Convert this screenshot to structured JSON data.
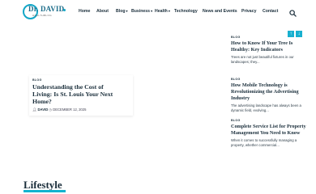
{
  "logo": {
    "name": "Dr. DAVID",
    "tagline": "HEALTHBLOG"
  },
  "nav": {
    "items": [
      {
        "label": "Home",
        "caret": ""
      },
      {
        "label": "About",
        "caret": ""
      },
      {
        "label": "Blog",
        "caret": "▾"
      },
      {
        "label": "Business",
        "caret": "▾"
      },
      {
        "label": "Health",
        "caret": "▾"
      },
      {
        "label": "Technology",
        "caret": ""
      },
      {
        "label": "News and Events",
        "caret": ""
      },
      {
        "label": "Privacy",
        "caret": ""
      },
      {
        "label": "Contact",
        "caret": ""
      }
    ],
    "search_icon": "search-icon"
  },
  "featured": {
    "category": "BLOG",
    "title": "Understanding the Cost of Living: Is St. Louis Your Next Home?",
    "author": "DAVID",
    "date": "DECEMBER 12, 2025"
  },
  "side_posts": [
    {
      "category": "BLOG",
      "title": "How to Know If Your Tree Is Healthy: Key Indicators",
      "excerpt": "Trees are not just beautiful fixtures in our landscapes; they..."
    },
    {
      "category": "BLOG",
      "title": "How Mobile Technology is Revolutionizing the Advertising Industry",
      "excerpt": "The advertising landscape has always been a dynamic field, evolving..."
    },
    {
      "category": "BLOG",
      "title": "Complete Service List for Property Management You Need to Know",
      "excerpt": "When it comes to successfully managing a property, whether commercial..."
    }
  ],
  "slider": {
    "up_label": "↑",
    "down_label": "↓"
  },
  "section": {
    "title": "Lifestyle"
  },
  "colors": {
    "accent": "#13b3cf",
    "text": "#1a2e3b",
    "logo": "#1c6d8a"
  }
}
